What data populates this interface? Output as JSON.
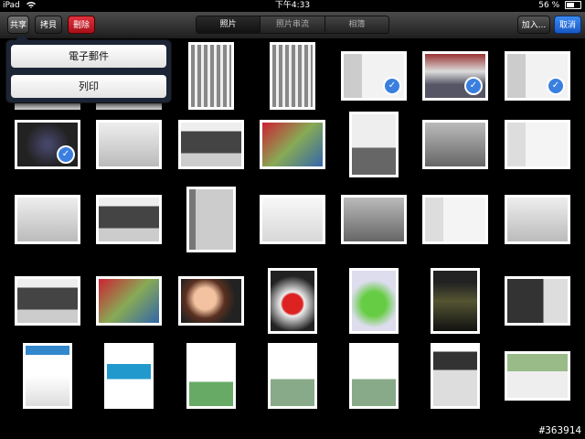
{
  "status": {
    "device": "iPad",
    "time": "下午4:33",
    "battery": "56 %",
    "battery_level": 0.56
  },
  "toolbar": {
    "share_label": "共享",
    "copy_label": "拷貝",
    "delete_label": "刪除",
    "tabs": [
      "照片",
      "照片串流",
      "相簿"
    ],
    "add_label": "加入...",
    "cancel_label": "取消"
  },
  "share_menu": {
    "items": [
      "電子郵件",
      "列印"
    ]
  },
  "watermark": "#363914",
  "colors": {
    "delete": "#c41e2a",
    "cancel": "#2a6fdc",
    "check": "#3a7fe0"
  }
}
